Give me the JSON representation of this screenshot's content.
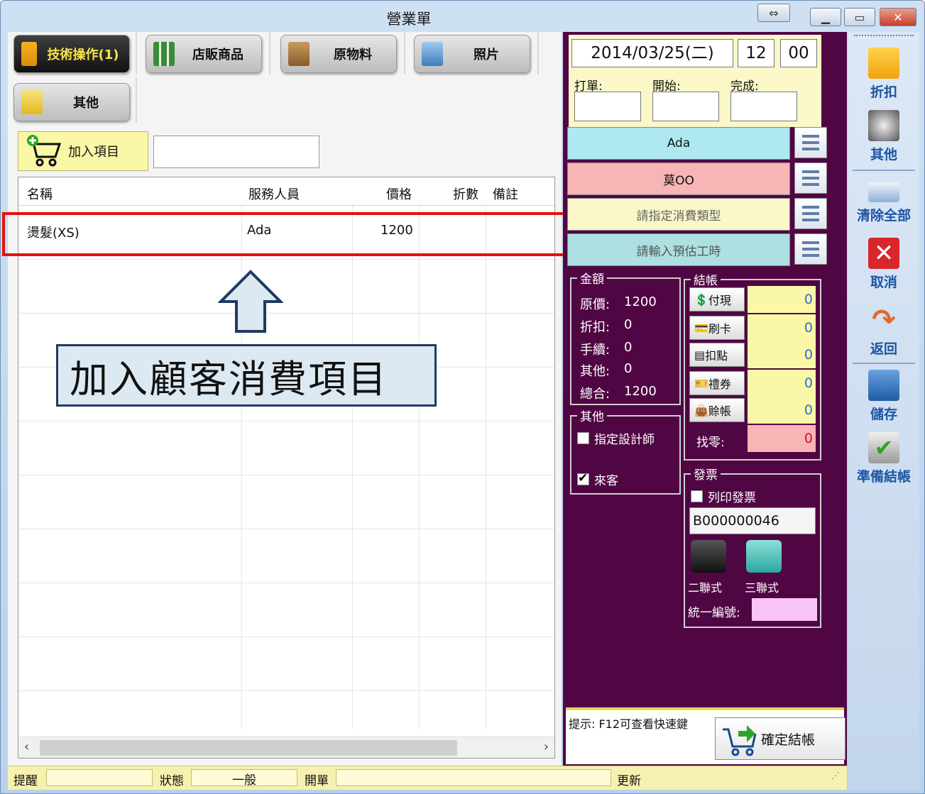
{
  "window": {
    "title": "營業單"
  },
  "categories": [
    {
      "label": "技術操作(1)",
      "active": true,
      "icon": "tech-operation-icon"
    },
    {
      "label": "店販商品",
      "active": false,
      "icon": "retail-products-icon"
    },
    {
      "label": "原物料",
      "active": false,
      "icon": "raw-materials-icon"
    },
    {
      "label": "照片",
      "active": false,
      "icon": "photos-icon"
    },
    {
      "label": "其他",
      "active": false,
      "icon": "other-icon"
    }
  ],
  "add_item": {
    "label": "加入項目",
    "input_value": ""
  },
  "grid": {
    "columns": [
      "名稱",
      "服務人員",
      "價格",
      "折數",
      "備註"
    ],
    "rows": [
      {
        "name": "燙髮(XS)",
        "staff": "Ada",
        "price": "1200",
        "discount": "",
        "note": ""
      }
    ]
  },
  "annotation": {
    "callout": "加入顧客消費項目"
  },
  "order": {
    "date": "2014/03/25(二)",
    "hour": "12",
    "minute": "00",
    "labels": {
      "print": "打單:",
      "start": "開始:",
      "done": "完成:"
    },
    "stylist": "Ada",
    "customer": "莫OO",
    "consume_type_placeholder": "請指定消費類型",
    "est_hours_placeholder": "請輸入預估工時"
  },
  "amount": {
    "title": "金額",
    "original_label": "原價:",
    "original": "1200",
    "discount_label": "折扣:",
    "discount": "0",
    "fee_label": "手續:",
    "fee": "0",
    "other_label": "其他:",
    "other": "0",
    "total_label": "總合:",
    "total": "1200"
  },
  "other_box": {
    "title": "其他",
    "assign_designer": "指定設計師",
    "walk_in": "來客",
    "assign_checked": false,
    "walkin_checked": true
  },
  "checkout": {
    "title": "結帳",
    "methods": [
      {
        "label": "付現",
        "value": "0"
      },
      {
        "label": "刷卡",
        "value": "0"
      },
      {
        "label": "扣點",
        "value": "0"
      },
      {
        "label": "禮券",
        "value": "0"
      },
      {
        "label": "賒帳",
        "value": "0"
      }
    ],
    "change_label": "找零:",
    "change_value": "0"
  },
  "invoice": {
    "title": "發票",
    "print_label": "列印發票",
    "number": "B000000046",
    "two_part": "二聯式",
    "three_part": "三聯式",
    "tax_id_label": "統一編號:"
  },
  "hint": {
    "text": "提示: F12可查看快速鍵",
    "confirm": "確定結帳"
  },
  "toolbar": {
    "discount": "折扣",
    "other": "其他",
    "clear_all": "清除全部",
    "cancel": "取消",
    "back": "返回",
    "save": "儲存",
    "prepare_checkout": "準備結帳"
  },
  "statusbar": {
    "remind": "提醒",
    "status": "狀態",
    "status_value": "一般",
    "open": "開單",
    "update": "更新"
  },
  "colors": {
    "accent_purple": "#510644",
    "highlight_red": "#e4120c",
    "stylist_bg": "#aee9f2",
    "customer_bg": "#f7b5b5"
  }
}
